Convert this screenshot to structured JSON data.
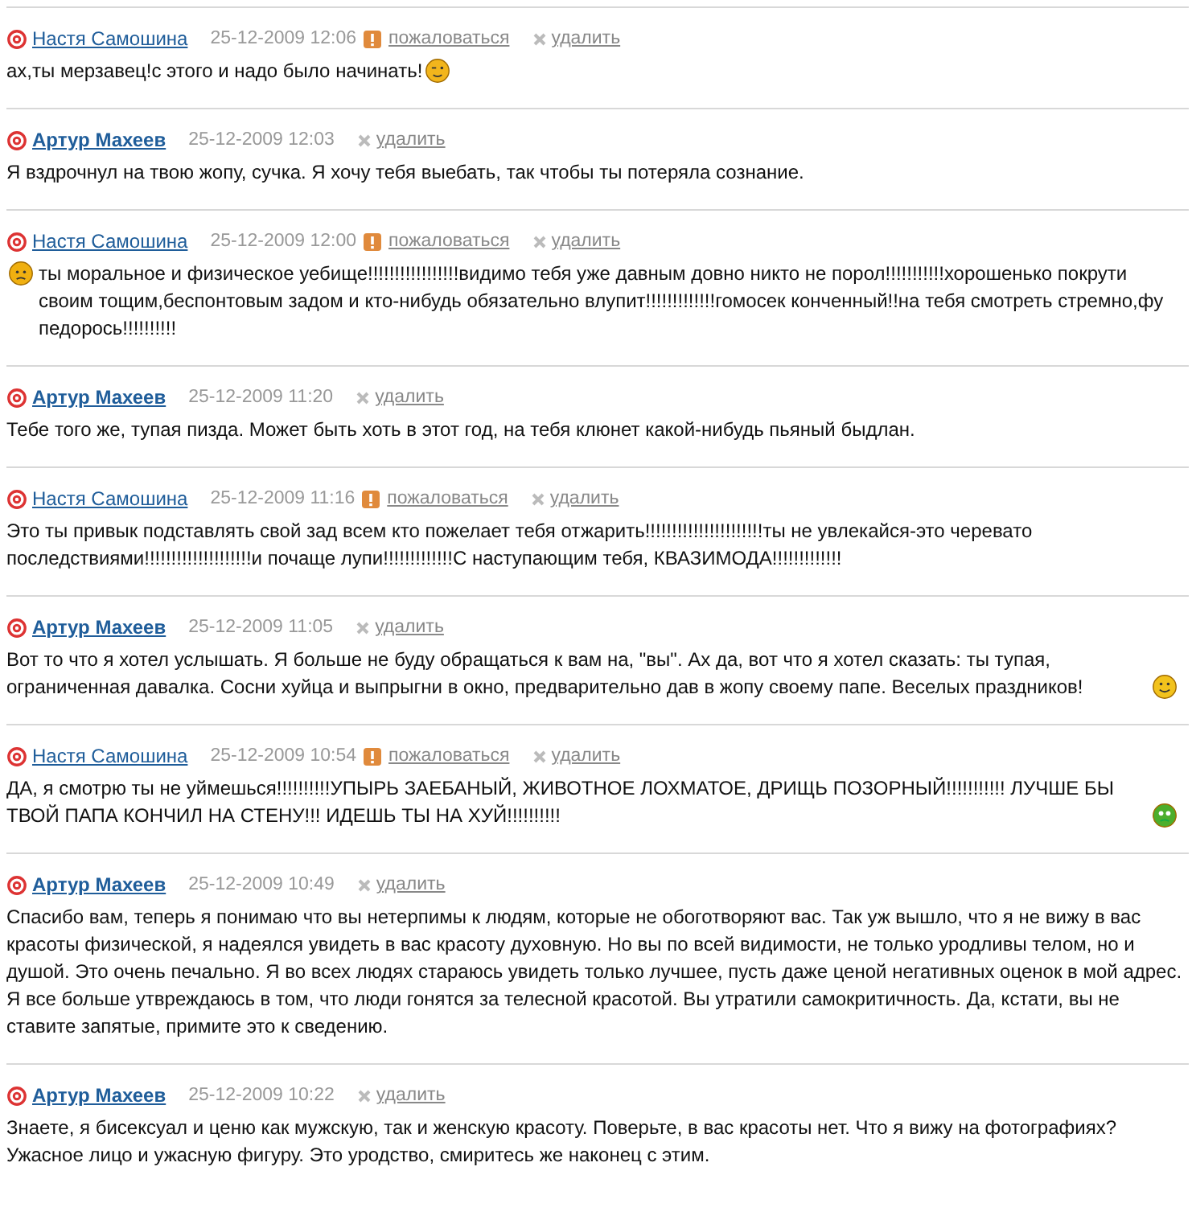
{
  "comments": [
    {
      "author": "Настя Самошина",
      "date": "25-12-2009 12:06",
      "report": "пожаловаться",
      "delete": "удалить",
      "text": "ах,ты мерзавец!с этого и надо было начинать!",
      "emoticon_after": {
        "kind": "wink"
      }
    },
    {
      "author": "Артур Махеев",
      "date": "25-12-2009 12:03",
      "delete": "удалить",
      "text": "Я вздрочнул на твою жопу, сучка. Я хочу тебя выебать, так чтобы ты потеряла сознание."
    },
    {
      "author": "Настя Самошина",
      "date": "25-12-2009 12:00",
      "report": "пожаловаться",
      "delete": "удалить",
      "text": "ты моральное и физическое уебище!!!!!!!!!!!!!!!!!видимо тебя уже давным довно никто не порол!!!!!!!!!!!хорошенько покрути своим тощим,беспонтовым задом и кто-нибудь обязательно влупит!!!!!!!!!!!!!гомосек конченный!!на тебя смотреть стремно,фу педорось!!!!!!!!!!",
      "emoticon_before": {
        "kind": "sweat"
      }
    },
    {
      "author": "Артур Махеев",
      "date": "25-12-2009 11:20",
      "delete": "удалить",
      "text": "Тебе того же, тупая пизда. Может быть хоть в этот год, на тебя клюнет какой-нибудь пьяный быдлан."
    },
    {
      "author": "Настя Самошина",
      "date": "25-12-2009 11:16",
      "report": "пожаловаться",
      "delete": "удалить",
      "text": "Это ты привык подставлять свой зад всем кто пожелает тебя отжарить!!!!!!!!!!!!!!!!!!!!!!ты не увлекайся-это черевато последствиями!!!!!!!!!!!!!!!!!!!!и почаще лупи!!!!!!!!!!!!!С наступающим тебя, КВАЗИМОДА!!!!!!!!!!!!!"
    },
    {
      "author": "Артур Махеев",
      "date": "25-12-2009 11:05",
      "delete": "удалить",
      "text": "Вот то что я хотел услышать. Я больше не буду обращаться к вам на, \"вы\". Ах да, вот что я хотел сказать: ты тупая, ограниченная давалка. Сосни хуйца и выпрыгни в окно, предварительно дав в жопу своему папе. Веселых праздников!",
      "emoticon_after": {
        "kind": "smile"
      }
    },
    {
      "author": "Настя Самошина",
      "date": "25-12-2009 10:54",
      "report": "пожаловаться",
      "delete": "удалить",
      "text": "ДА, я смотрю ты не уймешься!!!!!!!!!!УПЫРЬ ЗАЕБАНЫЙ, ЖИВОТНОЕ ЛОХМАТОЕ, ДРИЩЬ ПОЗОРНЫЙ!!!!!!!!!!! ЛУЧШЕ БЫ ТВОЙ ПАПА КОНЧИЛ НА СТЕНУ!!! ИДЕШЬ ТЫ НА ХУЙ!!!!!!!!!!",
      "emoticon_after": {
        "kind": "sick"
      }
    },
    {
      "author": "Артур Махеев",
      "date": "25-12-2009 10:49",
      "delete": "удалить",
      "text": "Спасибо вам, теперь я понимаю что вы нетерпимы к людям, которые не обоготворяют вас. Так уж вышло, что я не вижу в вас красоты физической, я надеялся увидеть в вас красоту духовную. Но вы по всей видимости, не только уродливы телом, но и душой. Это очень печально. Я во всех людях стараюсь увидеть только лучшее, пусть даже ценой негативных оценок в мой адрес. Я все больше утвреждаюсь в том, что люди гонятся за телесной красотой. Вы утратили самокритичность. Да, кстати, вы не ставите запятые, примите это к сведению."
    },
    {
      "author": "Артур Махеев",
      "date": "25-12-2009 10:22",
      "delete": "удалить",
      "text": "Знаете, я бисексуал и ценю как мужскую, так и женскую красоту. Поверьте, в вас красоты нет. Что я вижу на фотографиях? Ужасное лицо и ужасную фигуру. Это уродство, смиритесь же наконец с этим."
    }
  ]
}
